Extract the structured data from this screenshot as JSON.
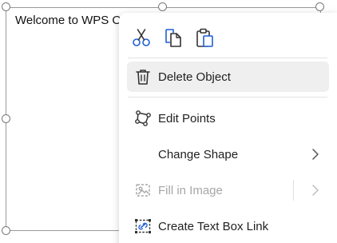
{
  "document": {
    "textbox_text": "Welcome to WPS O"
  },
  "context_menu": {
    "clipboard": [
      {
        "name": "cut-icon"
      },
      {
        "name": "copy-icon"
      },
      {
        "name": "paste-icon"
      }
    ],
    "items": [
      {
        "label": "Delete Object",
        "icon": "trash-icon",
        "hover": true
      },
      {
        "label": "Edit Points",
        "icon": "edit-points-icon"
      },
      {
        "label": "Change Shape",
        "icon": "",
        "submenu": true
      },
      {
        "label": "Fill in Image",
        "icon": "image-fill-icon",
        "submenu": true,
        "disabled": true
      },
      {
        "label": "Create Text Box Link",
        "icon": "text-box-link-icon"
      }
    ]
  },
  "colors": {
    "accent_blue": "#1f5fd6",
    "icon_dark": "#333333",
    "disabled": "#a6a6a6",
    "hover_bg": "#efefef"
  }
}
